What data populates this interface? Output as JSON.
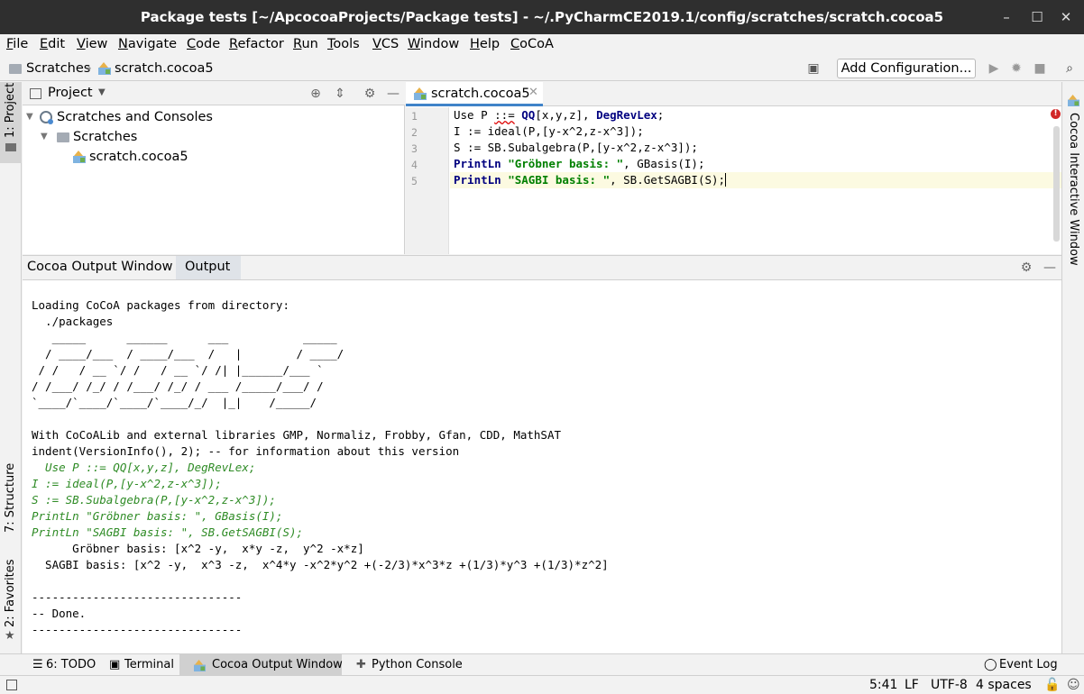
{
  "window": {
    "title": "Package tests [~/ApcocoaProjects/Package tests] - ~/.PyCharmCE2019.1/config/scratches/scratch.cocoa5",
    "minimize": "–",
    "maximize": "☐",
    "close": "✕"
  },
  "menu": [
    "File",
    "Edit",
    "View",
    "Navigate",
    "Code",
    "Refactor",
    "Run",
    "Tools",
    "VCS",
    "Window",
    "Help",
    "CoCoA"
  ],
  "breadcrumb": {
    "root": "Scratches",
    "file": "scratch.cocoa5"
  },
  "nav": {
    "add_config": "Add Configuration..."
  },
  "left_stripe": {
    "project": "1: Project",
    "structure": "7: Structure",
    "favorites": "2: Favorites"
  },
  "right_stripe": {
    "cocoa_interactive": "Cocoa Interactive Window"
  },
  "project_panel": {
    "title": "Project",
    "tree": [
      "Scratches and Consoles",
      "Scratches",
      "scratch.cocoa5"
    ]
  },
  "editor": {
    "tab": "scratch.cocoa5",
    "line_numbers": [
      "1",
      "2",
      "3",
      "4",
      "5"
    ],
    "lines": {
      "l1a": "Use P ",
      "l1b": "::=",
      "l1c": " ",
      "l1d": "QQ",
      "l1e": "[x,y,z], ",
      "l1f": "DegRevLex",
      "l1g": ";",
      "l2": "I := ideal(P,[y-x^2,z-x^3]);",
      "l3": "S := SB.Subalgebra(P,[y-x^2,z-x^3]);",
      "l4a": "PrintLn",
      "l4b": " ",
      "l4c": "\"Gröbner basis: \"",
      "l4d": ", GBasis(I);",
      "l5a": "PrintLn",
      "l5b": " ",
      "l5c": "\"SAGBI basis: \"",
      "l5d": ", SB.GetSAGBI(S);"
    },
    "error_mark": "!"
  },
  "output_panel": {
    "tabs": [
      "Cocoa Output Window",
      "Output"
    ],
    "lines": [
      "Loading CoCoA packages from directory:",
      "  ./packages",
      "   _____      ______      ___           _____",
      "  / ____/___  / ____/___  /   |        / ____/",
      " / /   / __ `/ /   / __ `/ /| |______/___ `",
      "/ /___/ /_/ / /___/ /_/ / ___ /_____/___/ /",
      "`____/`____/`____/`____/_/  |_|    /_____/",
      "",
      "With CoCoALib and external libraries GMP, Normaliz, Frobby, Gfan, CDD, MathSAT",
      "indent(VersionInfo(), 2); -- for information about this version"
    ],
    "echo": [
      "  Use P ::= QQ[x,y,z], DegRevLex;",
      "I := ideal(P,[y-x^2,z-x^3]);",
      "S := SB.Subalgebra(P,[y-x^2,z-x^3]);",
      "PrintLn \"Gröbner basis: \", GBasis(I);",
      "PrintLn \"SAGBI basis: \", SB.GetSAGBI(S);"
    ],
    "results": [
      "      Gröbner basis: [x^2 -y,  x*y -z,  y^2 -x*z]",
      "  SAGBI basis: [x^2 -y,  x^3 -z,  x^4*y -x^2*y^2 +(-2/3)*x^3*z +(1/3)*y^3 +(1/3)*z^2]",
      "",
      "-------------------------------",
      "-- Done.",
      "-------------------------------"
    ]
  },
  "tool_windows": {
    "todo": "6: TODO",
    "terminal": "Terminal",
    "cocoa_output": "Cocoa Output Window",
    "python_console": "Python Console",
    "event_log": "Event Log"
  },
  "status": {
    "position": "5:41",
    "line_sep": "LF",
    "encoding": "UTF-8",
    "indent": "4 spaces"
  }
}
